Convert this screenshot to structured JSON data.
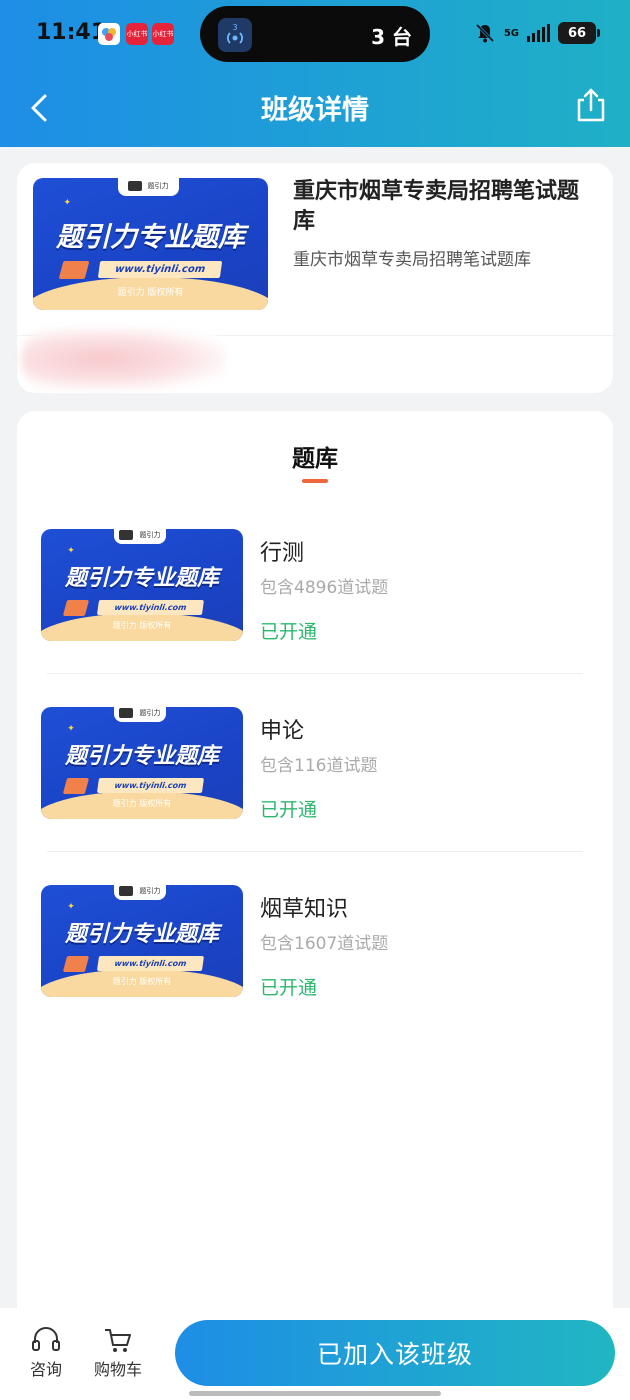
{
  "status_bar": {
    "time": "11:41",
    "apps": [
      "小红书",
      "小红书"
    ],
    "island_count": "3 台",
    "island_badge": "3",
    "network": "5G",
    "battery": "66"
  },
  "nav": {
    "title": "班级详情"
  },
  "class_card": {
    "title": "重庆市烟草专卖局招聘笔试题库",
    "subtitle": "重庆市烟草专卖局招聘笔试题库"
  },
  "thumbnail": {
    "headline": "题引力专业题库",
    "url": "www.tiyinli.com",
    "copyright": "题引力 版权所有",
    "tab_label": "题引力"
  },
  "section": {
    "title": "题库"
  },
  "question_banks": [
    {
      "name": "行测",
      "count": "包含4896道试题",
      "status": "已开通"
    },
    {
      "name": "申论",
      "count": "包含116道试题",
      "status": "已开通"
    },
    {
      "name": "烟草知识",
      "count": "包含1607道试题",
      "status": "已开通"
    }
  ],
  "bottom_bar": {
    "consult_label": "咨询",
    "cart_label": "购物车",
    "join_label": "已加入该班级"
  },
  "colors": {
    "accent_start": "#1e8ee6",
    "accent_end": "#1fb0c6",
    "status_green": "#2cb86c",
    "underline": "#f0673b"
  }
}
